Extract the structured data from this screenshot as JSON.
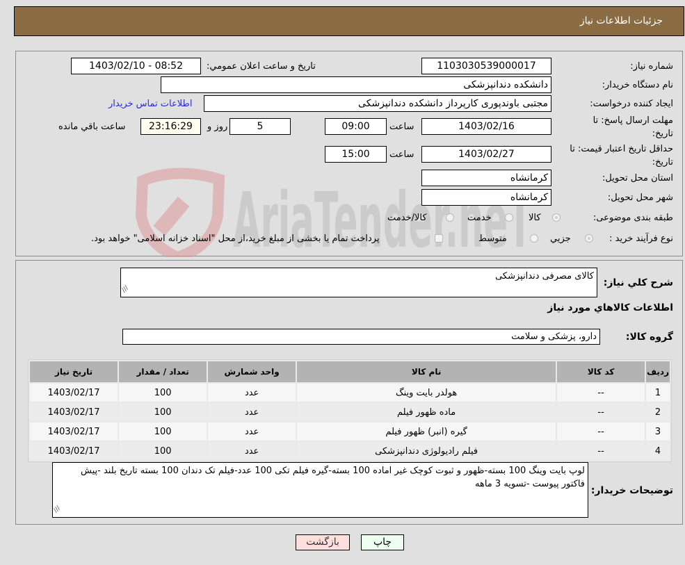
{
  "header": {
    "title": "جزئیات اطلاعات نیاز"
  },
  "details": {
    "need_number_label": "شماره نیاز:",
    "need_number": "1103030539000017",
    "announce_label": "تاریخ و ساعت اعلان عمومي:",
    "announce_value": "1403/02/10 - 08:52",
    "buyer_org_label": "نام دستگاه خريدار:",
    "buyer_org": "دانشکده دندانپزشکی",
    "creator_label": "ایجاد کننده درخواست:",
    "creator": "مجتبی  باوندپوری کارپرداز دانشکده دندانپزشکی",
    "contact_link": "اطلاعات تماس خریدار",
    "reply_deadline_label": "مهلت ارسال پاسخ: تا تاریخ:",
    "reply_date": "1403/02/16",
    "time_label": "ساعت",
    "reply_time": "09:00",
    "days_remaining": "5",
    "days_and_label": "روز و",
    "time_remaining": "23:16:29",
    "time_remaining_label": "ساعت باقي مانده",
    "price_validity_label": "حداقل تاریخ اعتبار قیمت: تا تاریخ:",
    "price_validity_date": "1403/02/27",
    "price_validity_time": "15:00",
    "province_label": "استان محل تحویل:",
    "province": "کرمانشاه",
    "city_label": "شهر محل تحویل:",
    "city": "کرمانشاه",
    "category_label": "طبقه بندی موضوعی:",
    "category_options": [
      "کالا",
      "خدمت",
      "کالا/خدمت"
    ],
    "process_label": "نوع فرآیند خرید :",
    "process_options": [
      "جزيي",
      "متوسط"
    ],
    "treasury_note": "پرداخت تمام یا بخشی از مبلغ خرید،از محل \"اسناد خزانه اسلامی\" خواهد بود."
  },
  "needs": {
    "summary_label": "شرح كلي نياز:",
    "summary": "کالای مصرفی دندانپزشکی",
    "items_heading": "اطلاعات كالاهاي مورد نياز",
    "group_label": "گروه کالا:",
    "group": "دارو، پزشکی و سلامت",
    "columns": [
      "رديف",
      "كد كالا",
      "نام كالا",
      "واحد شمارش",
      "تعداد / مقدار",
      "تاريخ نياز"
    ],
    "rows": [
      [
        "1",
        "--",
        "هولدر بایت وینگ",
        "عدد",
        "100",
        "1403/02/17"
      ],
      [
        "2",
        "--",
        "ماده ظهور فیلم",
        "عدد",
        "100",
        "1403/02/17"
      ],
      [
        "3",
        "--",
        "گیره (انبر) ظهور فیلم",
        "عدد",
        "100",
        "1403/02/17"
      ],
      [
        "4",
        "--",
        "فیلم رادیولوژی دندانپزشکی",
        "عدد",
        "100",
        "1403/02/17"
      ]
    ],
    "buyer_notes_label": "توضيحات خريدار:",
    "buyer_notes": "لوپ بایت وینگ 100 بسته-ظهور و ثبوت کوچک غیر اماده 100 بسته-گیره فیلم تکی 100 عدد-فیلم تک دندان 100 بسته  تاریخ بلند -پیش فاکتور پیوست -تسویه 3 ماهه"
  },
  "buttons": {
    "back": "بازگشت",
    "print": "چاپ"
  },
  "watermark": {
    "text": "AriaTender.neT"
  },
  "colors": {
    "header": "#8b6b41",
    "link": "#2a2ae0",
    "back_btn": "#ffdede",
    "print_btn": "#efffef"
  }
}
